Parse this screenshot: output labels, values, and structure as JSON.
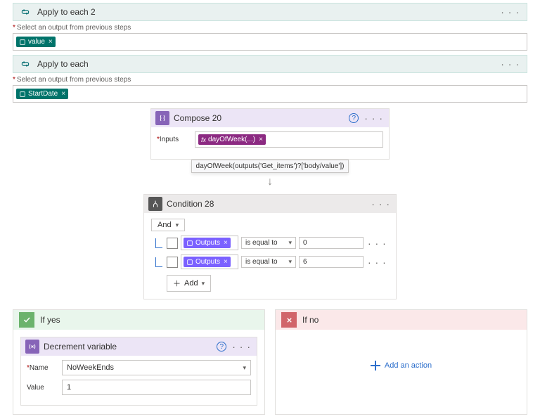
{
  "outerLoop": {
    "title": "Apply to each 2",
    "fieldLabel": "Select an output from previous steps",
    "token": "value"
  },
  "innerLoop": {
    "title": "Apply to each",
    "fieldLabel": "Select an output from previous steps",
    "token": "StartDate"
  },
  "compose": {
    "title": "Compose 20",
    "inputsLabel": "Inputs",
    "tokenLabel": "dayOfWeek(...)",
    "tooltip": "dayOfWeek(outputs('Get_items')?['body/value'])"
  },
  "condition": {
    "title": "Condition 28",
    "logic": "And",
    "rows": [
      {
        "left": "Outputs",
        "op": "is equal to",
        "right": "0"
      },
      {
        "left": "Outputs",
        "op": "is equal to",
        "right": "6"
      }
    ],
    "add": "Add"
  },
  "yesBranch": {
    "title": "If yes",
    "card": {
      "title": "Decrement variable",
      "nameLabel": "Name",
      "nameValue": "NoWeekEnds",
      "valueLabel": "Value",
      "valueValue": "1"
    }
  },
  "noBranch": {
    "title": "If no",
    "addAction": "Add an action"
  }
}
